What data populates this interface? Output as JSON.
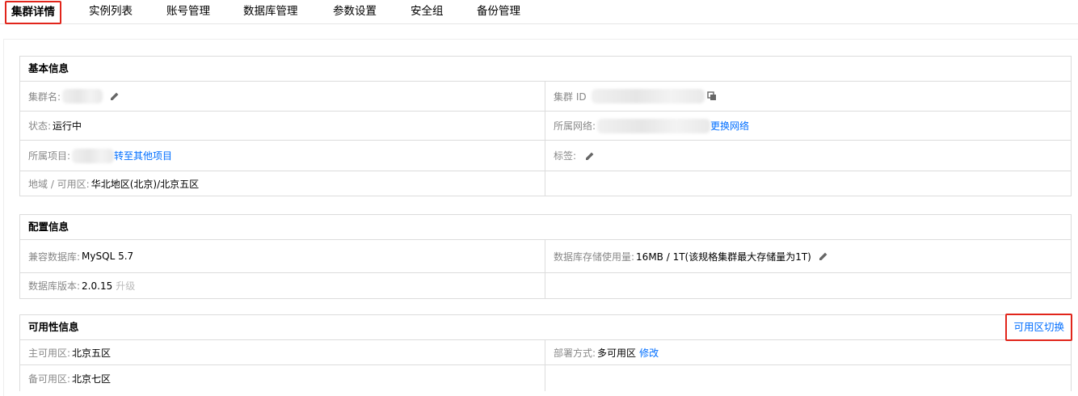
{
  "tabs": [
    {
      "label": "集群详情"
    },
    {
      "label": "实例列表"
    },
    {
      "label": "账号管理"
    },
    {
      "label": "数据库管理"
    },
    {
      "label": "参数设置"
    },
    {
      "label": "安全组"
    },
    {
      "label": "备份管理"
    }
  ],
  "basic": {
    "title": "基本信息",
    "cluster_name_label": "集群名:",
    "cluster_id_label": "集群 ID",
    "status_label": "状态:",
    "status_value": "运行中",
    "network_label": "所属网络:",
    "network_link": "更换网络",
    "project_label": "所属项目:",
    "project_link": "转至其他项目",
    "tags_label": "标签:",
    "region_label": "地域 / 可用区:",
    "region_value": "华北地区(北京)/北京五区"
  },
  "config": {
    "title": "配置信息",
    "compat_label": "兼容数据库:",
    "compat_value": "MySQL 5.7",
    "storage_label": "数据库存储使用量:",
    "storage_value": "16MB / 1T(该规格集群最大存储量为1T)",
    "version_label": "数据库版本:",
    "version_value": "2.0.15",
    "upgrade_link": "升级"
  },
  "availability": {
    "title": "可用性信息",
    "switch_link": "可用区切换",
    "primary_label": "主可用区:",
    "primary_value": "北京五区",
    "deploy_label": "部署方式:",
    "deploy_value": "多可用区",
    "modify_link": "修改",
    "backup_label": "备可用区:",
    "backup_value": "北京七区"
  },
  "icons": {
    "edit": "pencil-icon",
    "copy": "copy-icon"
  }
}
